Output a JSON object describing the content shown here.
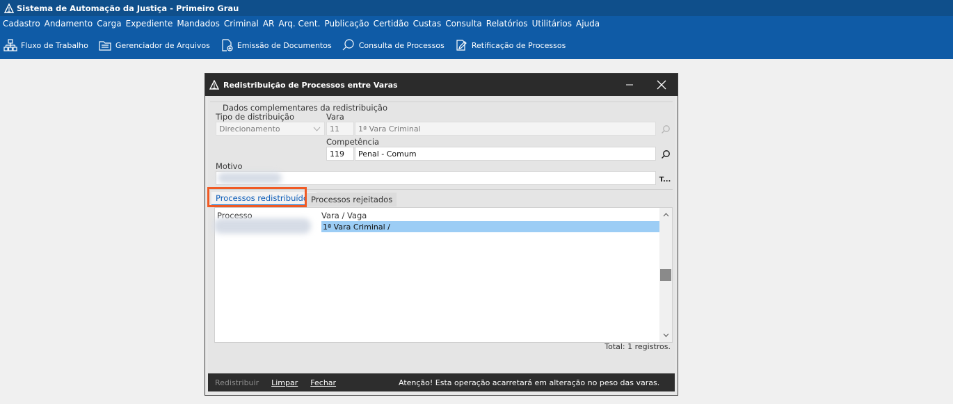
{
  "app": {
    "title": "Sistema de Automação da Justiça - Primeiro Grau"
  },
  "menu": [
    "Cadastro",
    "Andamento",
    "Carga",
    "Expediente",
    "Mandados",
    "Criminal",
    "AR",
    "Arq. Cent.",
    "Publicação",
    "Certidão",
    "Custas",
    "Consulta",
    "Relatórios",
    "Utilitários",
    "Ajuda"
  ],
  "toolbar": [
    {
      "label": "Fluxo de Trabalho",
      "icon": "workflow-icon"
    },
    {
      "label": "Gerenciador de Arquivos",
      "icon": "file-manager-icon"
    },
    {
      "label": "Emissão de Documentos",
      "icon": "document-add-icon"
    },
    {
      "label": "Consulta de Processos",
      "icon": "search-process-icon"
    },
    {
      "label": "Retificação de Processos",
      "icon": "edit-document-icon"
    }
  ],
  "dialog": {
    "title": "Redistribuição de Processos entre Varas",
    "group_title": "Dados complementares da redistribuição",
    "tipo_label": "Tipo de distribuição",
    "tipo_value": "Direcionamento",
    "vara_label": "Vara",
    "vara_code": "11",
    "vara_name": "1ª Vara Criminal",
    "competencia_label": "Competência",
    "competencia_code": "119",
    "competencia_name": "Penal - Comum",
    "motivo_label": "Motivo",
    "motivo_btn": "T...",
    "tabs": [
      "Processos redistribuídos",
      "Processos rejeitados"
    ],
    "columns": [
      "Processo",
      "Vara / Vaga"
    ],
    "row_vara": "1ª Vara Criminal /",
    "total": "Total: 1 registros.",
    "btn_redistribuir": "Redistribuir",
    "btn_limpar": "Limpar",
    "btn_fechar": "Fechar",
    "warning": "Atenção! Esta operação acarretará em alteração no peso das varas."
  },
  "colors": {
    "title_bar": "#0f4f8b",
    "menu_bar": "#0f5ba6",
    "highlight": "#f05a24",
    "selection": "#9ccdf5"
  }
}
